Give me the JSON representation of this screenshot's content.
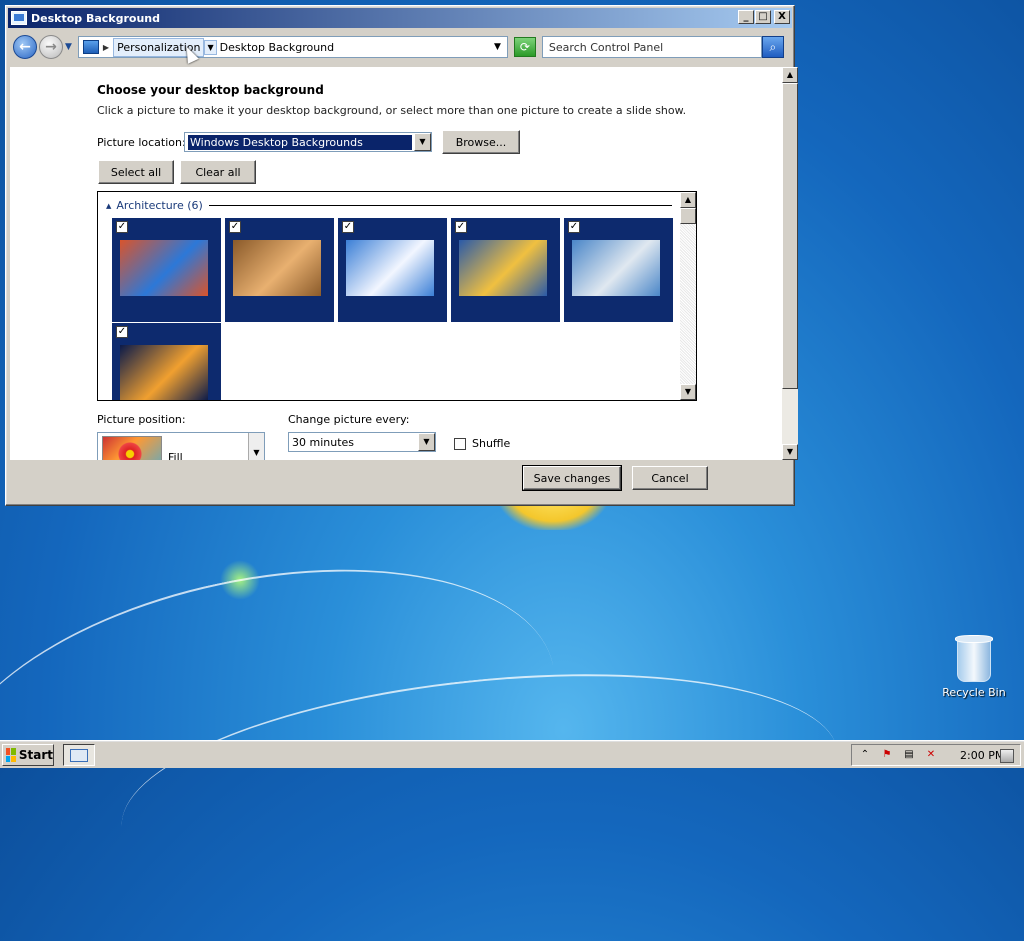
{
  "window": {
    "title": "Desktop Background",
    "controls": {
      "minimize": "_",
      "maximize": "□",
      "close": "X"
    }
  },
  "address": {
    "crumbs": [
      "Personalization",
      "Desktop Background"
    ],
    "search_placeholder": "Search Control Panel"
  },
  "main": {
    "heading": "Choose your desktop background",
    "description": "Click a picture to make it your desktop background, or select more than one picture to create a slide show.",
    "picture_location_label": "Picture location:",
    "picture_location_value": "Windows Desktop Backgrounds",
    "browse_label": "Browse...",
    "select_all_label": "Select all",
    "clear_all_label": "Clear all",
    "group_title": "Architecture (6)",
    "pictures": [
      {
        "checked": true,
        "colors": [
          "#d9542c",
          "#2c78d8"
        ]
      },
      {
        "checked": true,
        "colors": [
          "#8a5a2a",
          "#e8b070"
        ]
      },
      {
        "checked": true,
        "colors": [
          "#3b7fd6",
          "#f2f6ff"
        ]
      },
      {
        "checked": true,
        "colors": [
          "#2a5aa8",
          "#f0c040"
        ]
      },
      {
        "checked": true,
        "colors": [
          "#4a86c8",
          "#e0e8f0"
        ]
      },
      {
        "checked": true,
        "colors": [
          "#0a1a4a",
          "#f0a030"
        ]
      }
    ],
    "picture_position_label": "Picture position:",
    "picture_position_value": "Fill",
    "change_label": "Change picture every:",
    "change_value": "30 minutes",
    "shuffle_label": "Shuffle"
  },
  "footer": {
    "save_label": "Save changes",
    "cancel_label": "Cancel"
  },
  "desktop": {
    "recycle_bin_label": "Recycle Bin"
  },
  "taskbar": {
    "start_label": "Start",
    "clock": "2:00 PM"
  },
  "colors": {
    "titlebar_start": "#0a246a",
    "titlebar_end": "#a6caf0",
    "tile_background": "#0d2a6e",
    "desktop_blue": "#1467bd"
  }
}
